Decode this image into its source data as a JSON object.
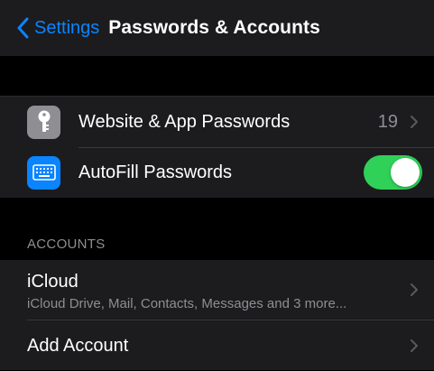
{
  "navbar": {
    "back_label": "Settings",
    "title": "Passwords & Accounts"
  },
  "passwords_group": {
    "website_app_passwords": {
      "label": "Website & App Passwords",
      "count": "19",
      "icon": "key-icon"
    },
    "autofill": {
      "label": "AutoFill Passwords",
      "icon": "keyboard-icon",
      "enabled": true
    }
  },
  "accounts": {
    "header": "ACCOUNTS",
    "icloud": {
      "title": "iCloud",
      "subtitle": "iCloud Drive, Mail, Contacts, Messages and 3 more..."
    },
    "add_account": {
      "label": "Add Account"
    }
  },
  "colors": {
    "accent": "#0a84ff",
    "toggle_on": "#30d158",
    "cell_background": "#1c1c1e",
    "secondary_text": "#8e8e93"
  }
}
